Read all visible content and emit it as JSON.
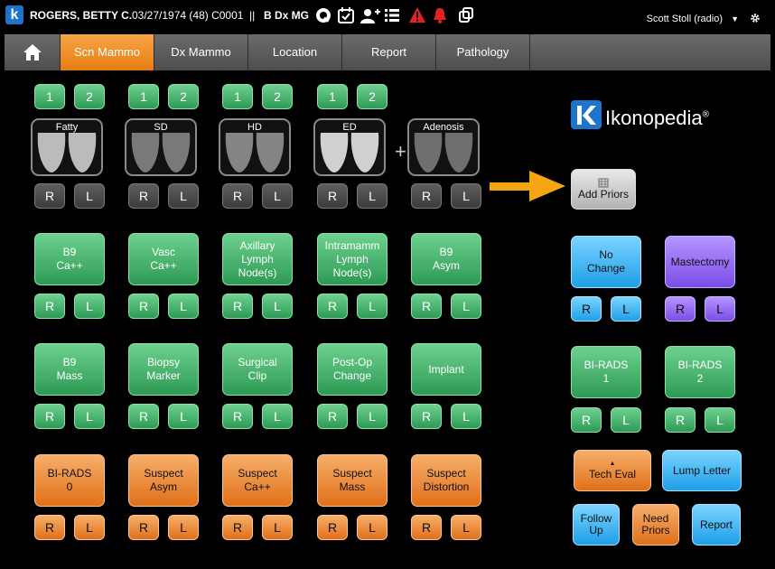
{
  "header": {
    "patient_name": "ROGERS, BETTY C.",
    "patient_info": "03/27/1974 (48) C0001",
    "separator": "||",
    "exam": "B Dx MG",
    "user": "Scott Stoll (radio)",
    "icons": [
      "ikonopedia-logo-icon",
      "q-icon",
      "calendar-check-icon",
      "add-user-icon",
      "list-icon",
      "warning-icon",
      "bell-icon",
      "copy-icon",
      "chevron-down-icon",
      "gear-icon"
    ],
    "colors": {
      "warning": "#e02424",
      "logo": "#1d74c9"
    }
  },
  "nav": {
    "home_icon": "home-icon",
    "tabs": [
      "Scn Mammo",
      "Dx Mammo",
      "Location",
      "Report",
      "Pathology"
    ],
    "active_tab": "Scn Mammo",
    "accent": "#f08a24"
  },
  "density": {
    "view_labels": [
      "1",
      "2"
    ],
    "images": [
      "Fatty",
      "SD",
      "HD",
      "ED",
      "Adenosis"
    ],
    "plus": "+",
    "side_labels": [
      "R",
      "L"
    ]
  },
  "findings": {
    "row1": [
      "B9\nCa++",
      "Vasc\nCa++",
      "Axillary\nLymph\nNode(s)",
      "Intramamm\nLymph\nNode(s)",
      "B9\nAsym"
    ],
    "row2": [
      "B9\nMass",
      "Biopsy\nMarker",
      "Surgical\nClip",
      "Post-Op\nChange",
      "Implant"
    ],
    "row3": [
      "BI-RADS\n0",
      "Suspect\nAsym",
      "Suspect\nCa++",
      "Suspect\nMass",
      "Suspect\nDistortion"
    ],
    "side_labels": [
      "R",
      "L"
    ]
  },
  "right_panel": {
    "brand": "Ikonopedia",
    "brand_mark": "®",
    "add_priors": "Add Priors",
    "no_change": "No\nChange",
    "mastectomy": "Mastectomy",
    "birads1": "BI-RADS\n1",
    "birads2": "BI-RADS\n2",
    "tech_eval": "Tech Eval",
    "lump_letter": "Lump Letter",
    "follow_up": "Follow\nUp",
    "need_priors": "Need\nPriors",
    "report": "Report",
    "side_labels": [
      "R",
      "L"
    ]
  }
}
